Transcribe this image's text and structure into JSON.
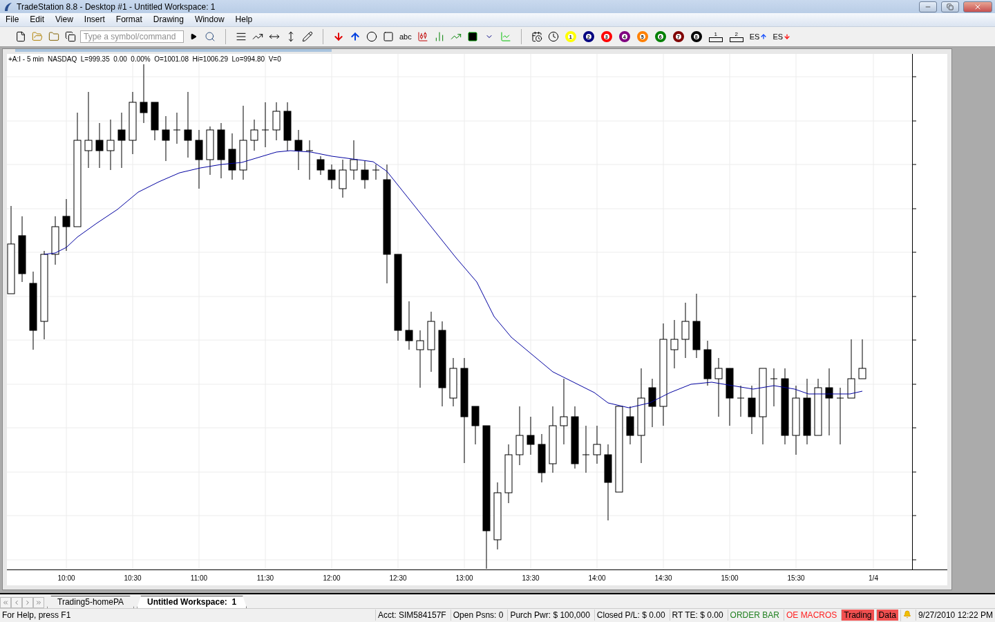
{
  "window": {
    "title": "TradeStation 8.8 - Desktop #1 - Untitled Workspace: 1"
  },
  "menu": [
    "File",
    "Edit",
    "View",
    "Insert",
    "Format",
    "Drawing",
    "Window",
    "Help"
  ],
  "toolbar": {
    "symbol_field": {
      "placeholder": "Type a symbol/command"
    },
    "text_tool": "abc",
    "price_alerts": [
      {
        "label": "1",
        "color": "#ffff00"
      },
      {
        "label": "2",
        "color": "#000080"
      },
      {
        "label": "3",
        "color": "#ff0000"
      },
      {
        "label": "4",
        "color": "#800080"
      },
      {
        "label": "5",
        "color": "#ff8000"
      },
      {
        "label": "6",
        "color": "#008000"
      },
      {
        "label": "7",
        "color": "#800000"
      },
      {
        "label": "8",
        "color": "#000000"
      }
    ],
    "levels": [
      "1",
      "2"
    ],
    "es_buttons": [
      {
        "label": "ES",
        "kind": "up"
      },
      {
        "label": "ES",
        "kind": "down"
      }
    ]
  },
  "chart": {
    "header": "+A:I - 5 min  NASDAQ  L=999.35  0.00  0.00%  O=1001.08  Hi=1006.29  Lo=994.80  V=0",
    "x_labels": [
      "10:00",
      "10:30",
      "11:00",
      "11:30",
      "12:00",
      "12:30",
      "13:00",
      "13:30",
      "14:00",
      "14:30",
      "15:00",
      "15:30",
      "1/4"
    ]
  },
  "tabs": [
    {
      "label": "Trading5-homePA",
      "selected": false
    },
    {
      "label": "Untitled Workspace:  1",
      "selected": true
    }
  ],
  "status_bar": {
    "help": "For Help, press F1",
    "fields": [
      {
        "text": "Acct: SIM584157F",
        "kind": "plain"
      },
      {
        "text": "Open Psns: 0",
        "kind": "plain"
      },
      {
        "text": "Purch Pwr: $ 100,000",
        "kind": "plain"
      },
      {
        "text": "Closed P/L: $ 0.00",
        "kind": "plain"
      },
      {
        "text": "RT TE: $ 0.00",
        "kind": "plain"
      },
      {
        "text": "ORDER BAR",
        "kind": "active"
      },
      {
        "text": "OE MACROS",
        "kind": "inactive"
      },
      {
        "text": "Trading",
        "kind": "alarm"
      },
      {
        "text": "Data",
        "kind": "alarm"
      }
    ],
    "time": "9/27/2010 12:22 PM"
  }
}
